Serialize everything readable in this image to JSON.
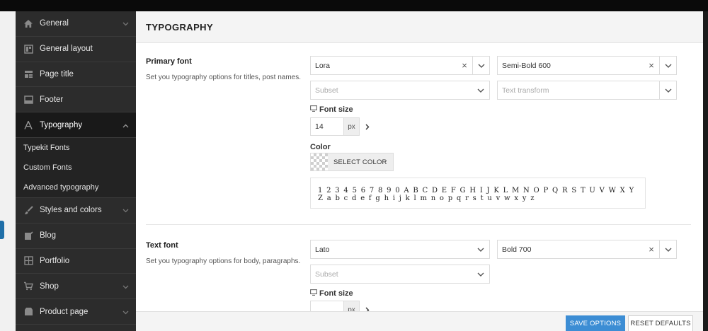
{
  "sidebar": {
    "items": [
      {
        "label": "General",
        "icon": "home-icon",
        "has_chevron": true
      },
      {
        "label": "General layout",
        "icon": "layout-icon",
        "has_chevron": false
      },
      {
        "label": "Page title",
        "icon": "page-title-icon",
        "has_chevron": false
      },
      {
        "label": "Footer",
        "icon": "footer-icon",
        "has_chevron": false
      },
      {
        "label": "Typography",
        "icon": "typography-icon",
        "has_chevron": true,
        "active": true
      },
      {
        "label": "Styles and colors",
        "icon": "brush-icon",
        "has_chevron": true
      },
      {
        "label": "Blog",
        "icon": "blog-icon",
        "has_chevron": false
      },
      {
        "label": "Portfolio",
        "icon": "portfolio-icon",
        "has_chevron": false
      },
      {
        "label": "Shop",
        "icon": "cart-icon",
        "has_chevron": true
      },
      {
        "label": "Product page",
        "icon": "product-icon",
        "has_chevron": true
      }
    ],
    "typography_subitems": [
      "Typekit Fonts",
      "Custom Fonts",
      "Advanced typography"
    ]
  },
  "header": {
    "title": "TYPOGRAPHY"
  },
  "primary_font": {
    "label": "Primary font",
    "description": "Set you typography options for titles, post names.",
    "family": "Lora",
    "weight": "Semi-Bold 600",
    "subset_placeholder": "Subset",
    "transform_placeholder": "Text transform",
    "font_size_label": "Font size",
    "font_size_value": "14",
    "font_size_unit": "px",
    "color_label": "Color",
    "color_button": "SELECT COLOR",
    "preview_text": "1 2 3 4 5 6 7 8 9 0 A B C D E F G H I J K L M N O P Q R S T U V W X Y Z a b c d e f g h i j k l m n o p q r s t u v w x y z"
  },
  "text_font": {
    "label": "Text font",
    "description": "Set you typography options for body, paragraphs.",
    "family": "Lato",
    "weight": "Bold 700",
    "subset_placeholder": "Subset",
    "font_size_label": "Font size",
    "font_size_value": "",
    "font_size_unit": "px"
  },
  "footer": {
    "save_label": "SAVE OPTIONS",
    "reset_label": "RESET DEFAULTS"
  },
  "colors": {
    "sidebar_bg": "#2c2c2c",
    "sidebar_active_bg": "#191919",
    "save_button": "#3c8dd4"
  }
}
